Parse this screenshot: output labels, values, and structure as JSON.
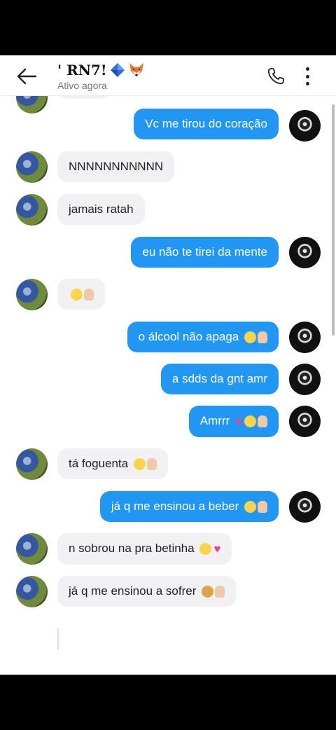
{
  "header": {
    "title": "' RN7!",
    "title_emojis": [
      "blue-diamond",
      "fox-face"
    ],
    "status": "Ativo agora"
  },
  "colors": {
    "outgoing_bubble": "#2196f3",
    "incoming_bubble": "#f1f1f3"
  },
  "messages": [
    {
      "dir": "out",
      "text": "Vc me tirou do coração",
      "emojis": []
    },
    {
      "dir": "in",
      "text": "NNNNNNNNNNN",
      "emojis": []
    },
    {
      "dir": "in",
      "text": "jamais ratah",
      "emojis": []
    },
    {
      "dir": "out",
      "text": "eu não te tirei da mente",
      "emojis": []
    },
    {
      "dir": "in",
      "text": "",
      "emojis": [
        "smirk-face",
        "raised-hand"
      ]
    },
    {
      "dir": "out",
      "text": "o álcool não apaga",
      "emojis": [
        "confounded-face",
        "pointing-up-hand"
      ]
    },
    {
      "dir": "out",
      "text": "a sdds da gnt amr",
      "emojis": []
    },
    {
      "dir": "out",
      "text": "Amrrr",
      "emojis": [
        "pink-heart",
        "pensive-face",
        "pointing-up-hand"
      ]
    },
    {
      "dir": "in",
      "text": "tá foguenta",
      "emojis": [
        "disappointed-face",
        "victory-hand"
      ]
    },
    {
      "dir": "out",
      "text": "já q me ensinou a beber",
      "emojis": [
        "pensive-face",
        "pointing-up-hand"
      ]
    },
    {
      "dir": "in",
      "text": "n sobrou na pra betinha",
      "emojis": [
        "pensive-face",
        "broken-heart"
      ]
    },
    {
      "dir": "in",
      "text": "já q me ensinou a sofrer",
      "emojis": [
        "cowboy-face",
        "thumbs-up"
      ]
    }
  ]
}
